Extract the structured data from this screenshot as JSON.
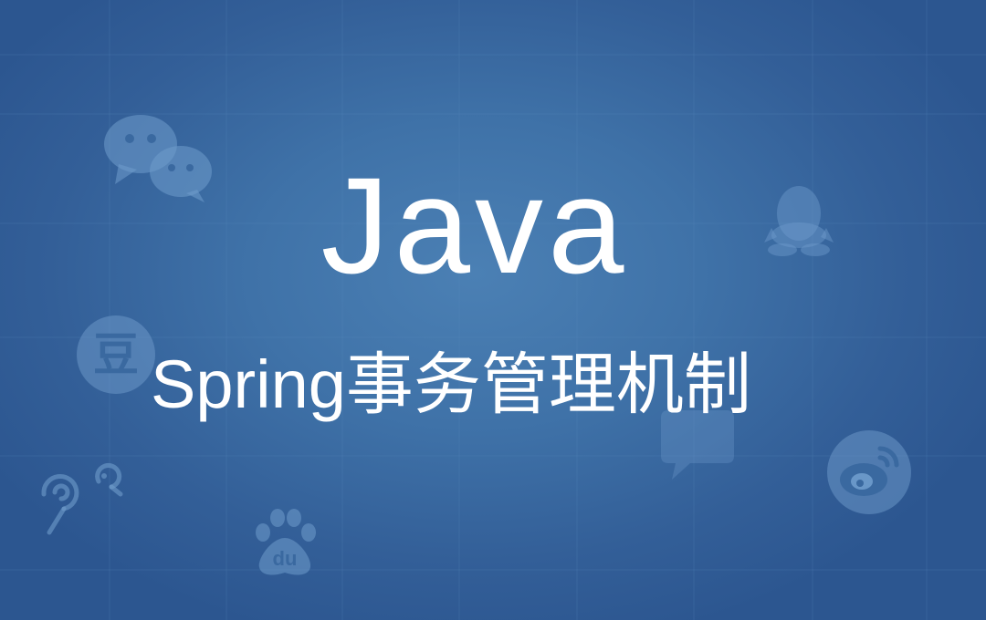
{
  "title": "Java",
  "subtitle": "Spring事务管理机制",
  "icons": {
    "wechat": "wechat-icon",
    "qq": "qq-icon",
    "douban": {
      "name": "douban-icon",
      "glyph": "豆"
    },
    "weibo": "weibo-icon",
    "baidu": {
      "name": "baidu-icon",
      "glyph": "du"
    },
    "podcast": "podcast-icon",
    "message": "message-icon"
  },
  "colors": {
    "background_center": "#4b80b4",
    "background_edge": "#2c5690",
    "text": "#ffffff",
    "icon_tint": "#6f9ccc"
  }
}
